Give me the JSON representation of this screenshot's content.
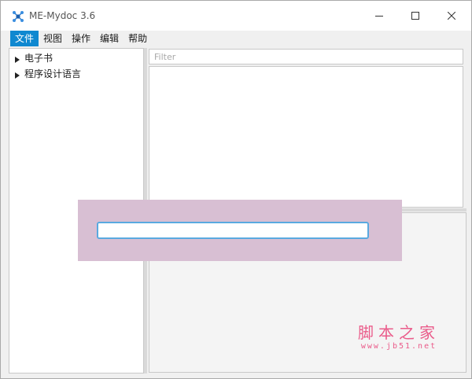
{
  "window": {
    "title": "ME-Mydoc 3.6",
    "icon": "molecule-app-icon",
    "controls": [
      "minimize-icon",
      "maximize-icon",
      "close-icon"
    ]
  },
  "menu": {
    "items": [
      {
        "label": "文件",
        "active": true
      },
      {
        "label": "视图",
        "active": false
      },
      {
        "label": "操作",
        "active": false
      },
      {
        "label": "编辑",
        "active": false
      },
      {
        "label": "帮助",
        "active": false
      }
    ]
  },
  "tree": {
    "items": [
      {
        "label": "电子书",
        "expanded": false
      },
      {
        "label": "程序设计语言",
        "expanded": false
      }
    ]
  },
  "filter": {
    "placeholder": "Filter",
    "value": ""
  },
  "overlay": {
    "input_value": ""
  },
  "watermark": {
    "main": "脚本之家",
    "sub": "www.jb51.net"
  },
  "colors": {
    "accent": "#0f88d0",
    "overlay": "#d8bfd3",
    "focus_border": "#5aa9e0",
    "watermark": "#ea5b8a"
  }
}
